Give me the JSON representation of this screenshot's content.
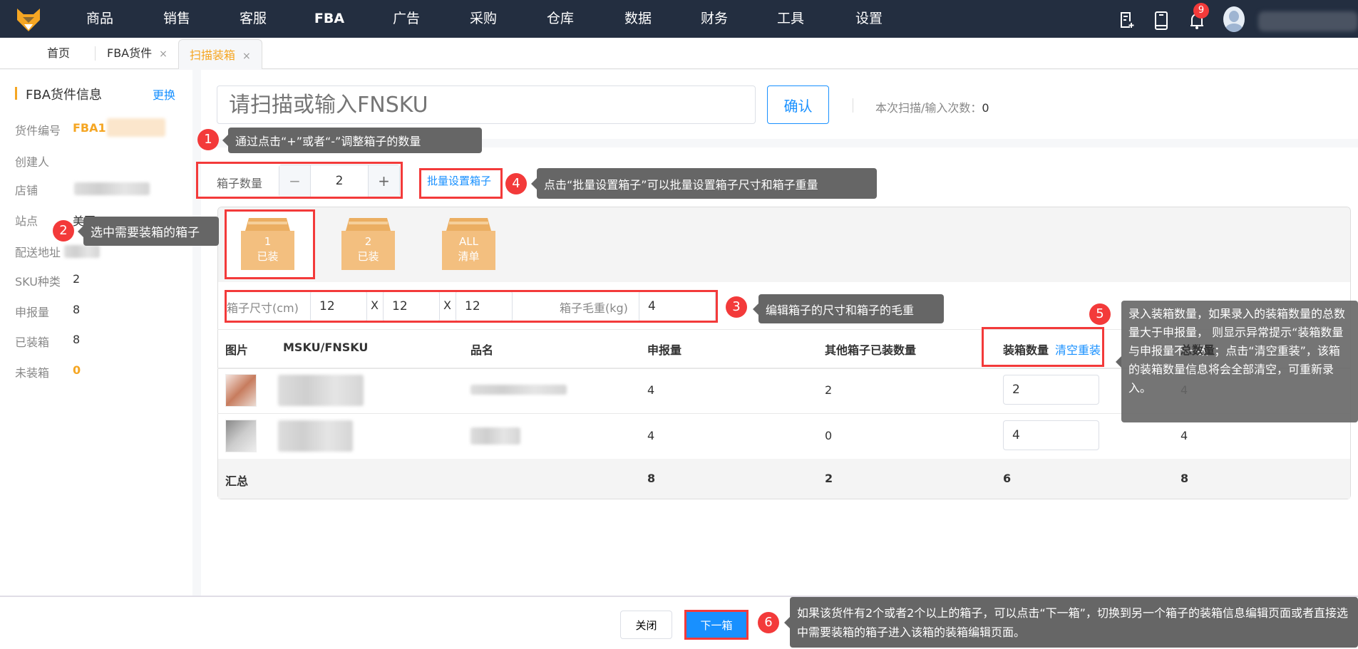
{
  "nav": {
    "items": [
      "商品",
      "销售",
      "客服",
      "FBA",
      "广告",
      "采购",
      "仓库",
      "数据",
      "财务",
      "工具",
      "设置"
    ],
    "notification_count": "9"
  },
  "tabs": [
    {
      "label": "首页"
    },
    {
      "label": "FBA货件"
    },
    {
      "label": "扫描装箱"
    }
  ],
  "sidebar": {
    "title": "FBA货件信息",
    "change_link": "更换",
    "fields": [
      {
        "label": "货件编号",
        "value": "FBA1"
      },
      {
        "label": "创建人",
        "value": ""
      },
      {
        "label": "店铺",
        "value": ""
      },
      {
        "label": "站点",
        "value": "美国"
      },
      {
        "label": "配送地址",
        "value": ""
      },
      {
        "label": "SKU种类",
        "value": "2"
      },
      {
        "label": "申报量",
        "value": "8"
      },
      {
        "label": "已装箱",
        "value": "8"
      },
      {
        "label": "未装箱",
        "value": "0"
      }
    ]
  },
  "scan": {
    "placeholder": "请扫描或输入FNSKU",
    "confirm": "确认",
    "count_label": "本次扫描/输入次数：",
    "count": "0"
  },
  "boxcount": {
    "label": "箱子数量",
    "value": "2",
    "minus": "−",
    "plus": "+",
    "batch_link": "批量设置箱子"
  },
  "boxes": [
    {
      "num": "1",
      "status": "已装"
    },
    {
      "num": "2",
      "status": "已装"
    },
    {
      "num": "ALL",
      "status": "清单"
    }
  ],
  "dims": {
    "label": "箱子尺寸(cm)",
    "l": "12",
    "w": "12",
    "h": "12",
    "x": "X",
    "weight_label": "箱子毛重(kg)",
    "weight": "4"
  },
  "table": {
    "headers": [
      "图片",
      "MSKU/FNSKU",
      "品名",
      "申报量",
      "其他箱子已装数量",
      "装箱数量",
      "总数量"
    ],
    "clear_link": "清空重装",
    "rows": [
      {
        "declared": "4",
        "others": "2",
        "qty": "2",
        "total": "4"
      },
      {
        "declared": "4",
        "others": "0",
        "qty": "4",
        "total": "4"
      }
    ],
    "summary": {
      "label": "汇总",
      "declared": "8",
      "others": "2",
      "qty": "6",
      "total": "8"
    }
  },
  "footer": {
    "close": "关闭",
    "next": "下一箱"
  },
  "tips": [
    {
      "n": "1",
      "text": "通过点击“+”或者“-”调整箱子的数量"
    },
    {
      "n": "2",
      "text": "选中需要装箱的箱子"
    },
    {
      "n": "3",
      "text": "编辑箱子的尺寸和箱子的毛重"
    },
    {
      "n": "4",
      "text": "点击“批量设置箱子”可以批量设置箱子尺寸和箱子重量"
    },
    {
      "n": "5",
      "text": "录入装箱数量，如果录入的装箱数量的总数量大于申报量， 则显示异常提示“装箱数量与申报量不一致”；点击“清空重装”，该箱的装箱数量信息将会全部清空，可重新录入。"
    },
    {
      "n": "6",
      "text": "如果该货件有2个或者2个以上的箱子，可以点击“下一箱”，切换到另一个箱子的装箱信息编辑页面或者直接选中需要装箱的箱子进入该箱的装箱编辑页面。"
    }
  ],
  "colors": {
    "accent": "#1890ff",
    "orange": "#f5a623",
    "red": "#f33a3a",
    "nav_bg": "#232e40"
  }
}
